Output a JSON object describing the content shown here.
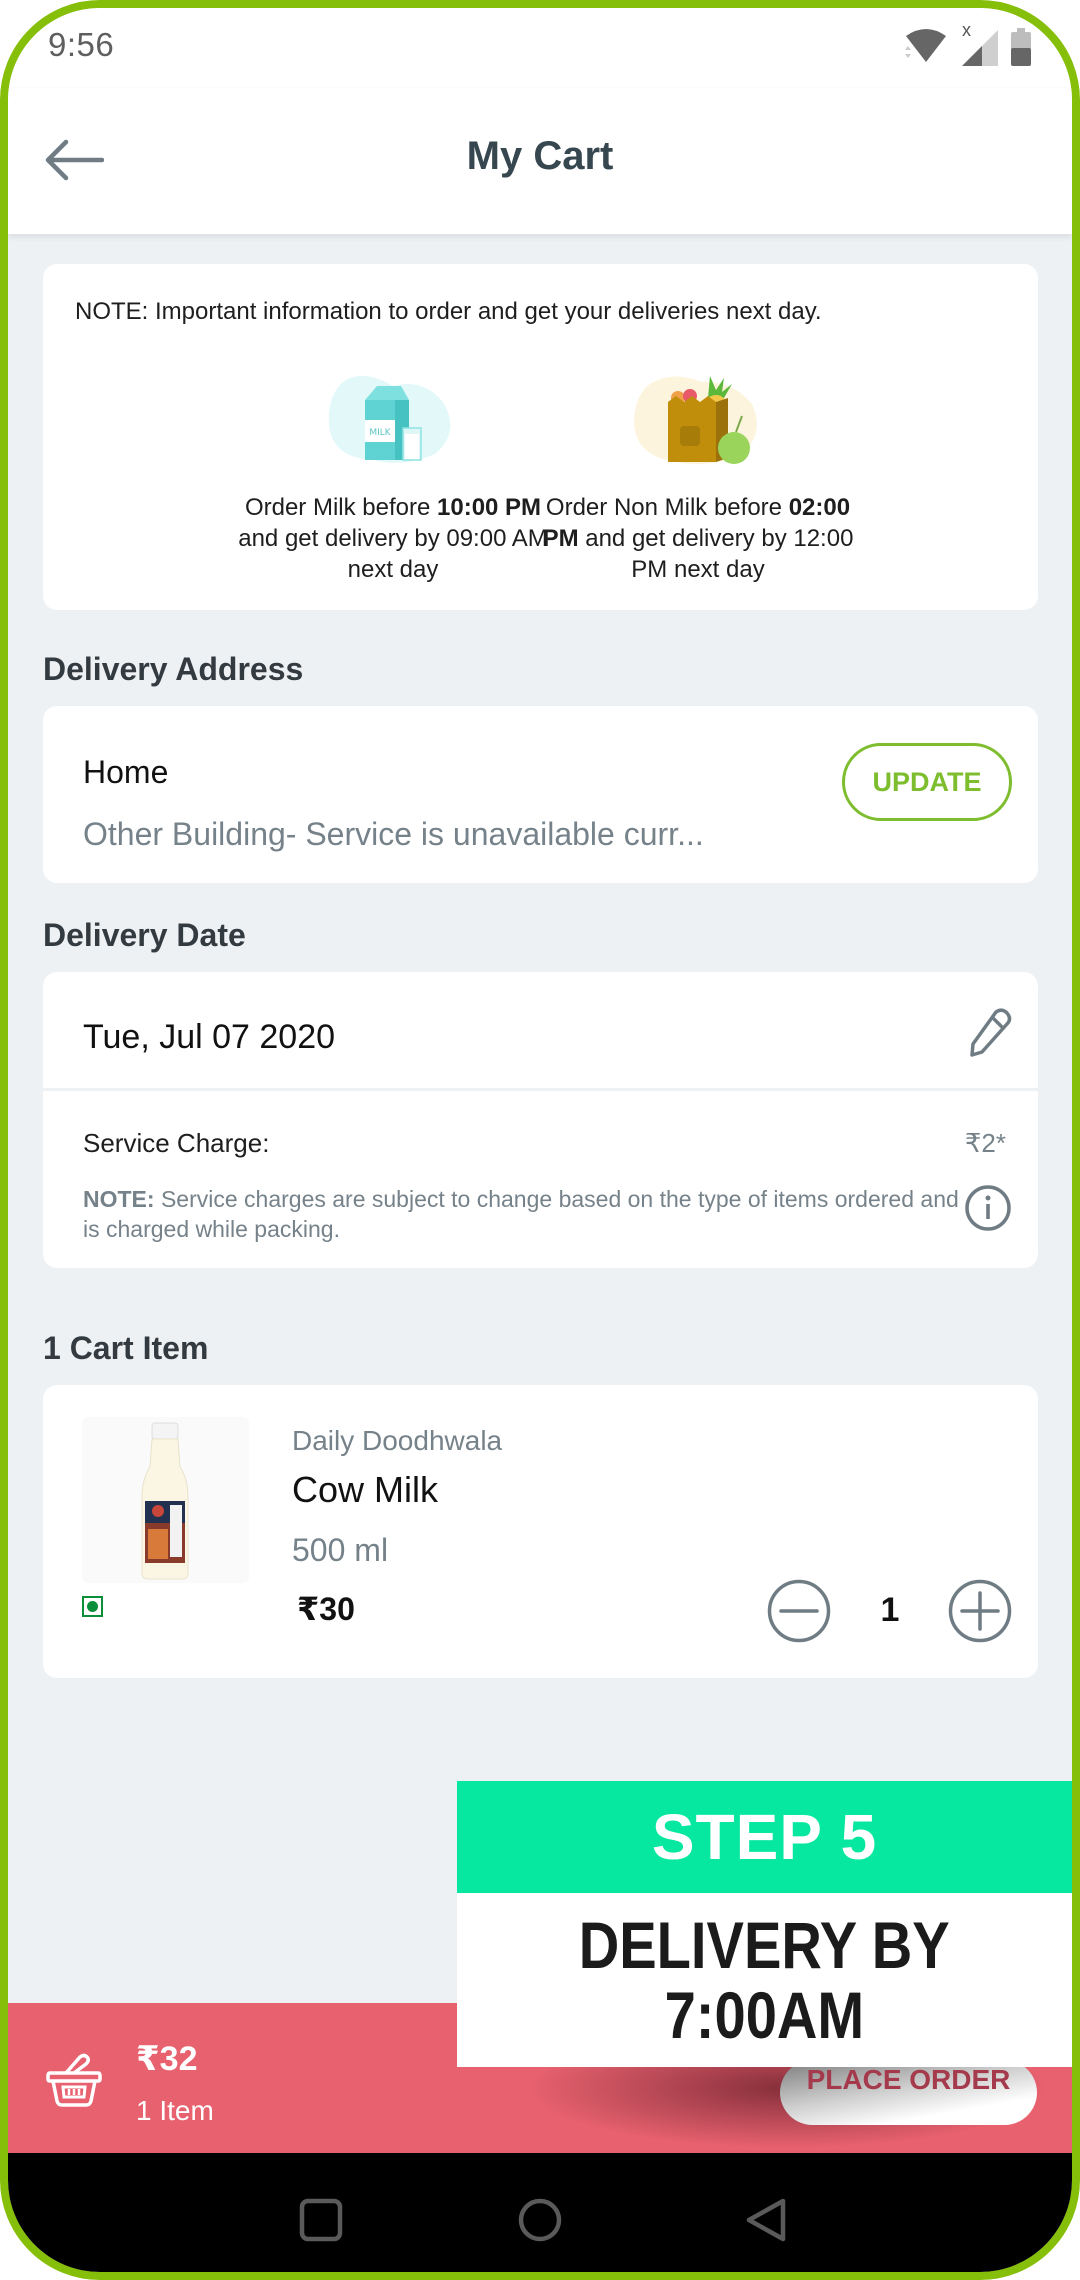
{
  "status_bar": {
    "time": "9:56",
    "icons": [
      "wifi-icon",
      "signal-icon",
      "battery-icon"
    ],
    "signal_badge": "x"
  },
  "header": {
    "back_icon": "arrow-left-icon",
    "title": "My Cart"
  },
  "note_card": {
    "text": "NOTE: Important information to order and get your deliveries next day.",
    "columns": [
      {
        "icon": "milk-carton-icon",
        "icon_label": "MILK",
        "caption_pre": "Order Milk before ",
        "caption_bold": "10:00 PM",
        "caption_post": " and get delivery by 09:00 AM next day"
      },
      {
        "icon": "grocery-bag-icon",
        "caption_pre": "Order Non Milk before ",
        "caption_bold": "02:00 PM",
        "caption_post": " and get delivery by 12:00 PM next day"
      }
    ]
  },
  "delivery_address": {
    "section_title": "Delivery Address",
    "label": "Home",
    "address": "Other Building- Service is unavailable curr...",
    "update_label": "UPDATE"
  },
  "delivery_date": {
    "section_title": "Delivery Date",
    "date": "Tue, Jul 07 2020",
    "edit_icon": "pencil-icon",
    "service_charge_label": "Service Charge:",
    "service_charge_amount": "₹2*",
    "note_bold": "NOTE:",
    "note_text": " Service charges are subject to change based on the type of items ordered and is charged while packing.",
    "info_icon": "info-icon"
  },
  "cart": {
    "section_title": "1 Cart Item",
    "items": [
      {
        "brand": "Daily Doodhwala",
        "name": "Cow Milk",
        "size": "500 ml",
        "price": "₹30",
        "quantity": "1",
        "veg": true
      }
    ]
  },
  "cart_bar": {
    "total": "₹32",
    "item_count": "1 Item",
    "place_order_label": "PLACE ORDER"
  },
  "overlay": {
    "step": "STEP 5",
    "line1": "DELIVERY BY",
    "line2": "7:00AM"
  },
  "nav_bar": {
    "buttons": [
      "recents-square-icon",
      "home-circle-icon",
      "back-triangle-icon"
    ]
  },
  "colors": {
    "frame": "#86bf0a",
    "accent_green": "#7dbd2e",
    "cart_bar": "#e8616f",
    "banner_green": "#06e8a0",
    "title": "#37474f",
    "muted": "#76828a",
    "background": "#edf1f4"
  }
}
